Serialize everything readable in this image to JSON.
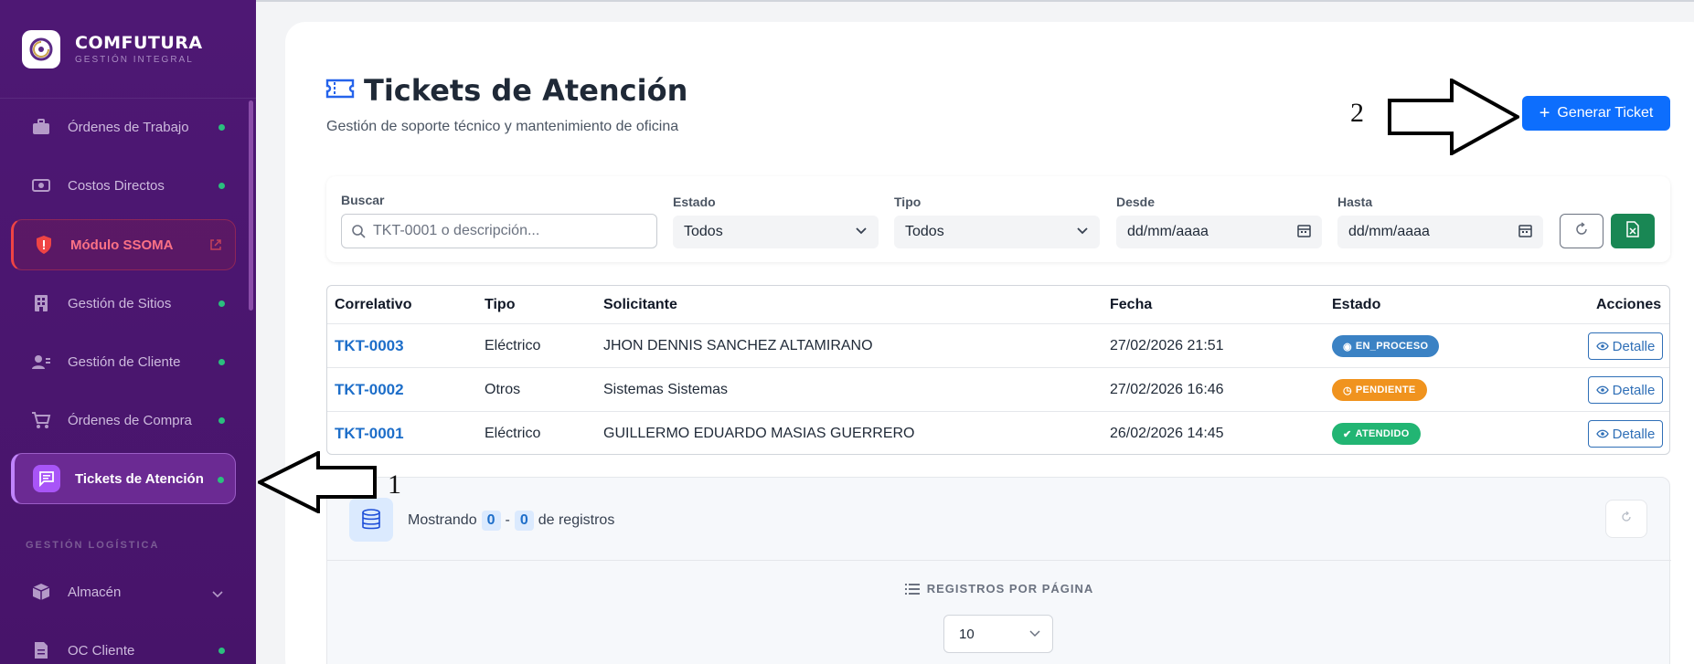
{
  "brand": {
    "name": "COMFUTURA",
    "sub": "GESTIÓN INTEGRAL"
  },
  "sidebar": {
    "items": [
      {
        "label": "Órdenes de Trabajo",
        "icon": "briefcase-icon"
      },
      {
        "label": "Costos Directos",
        "icon": "cash-icon"
      },
      {
        "label": "Módulo SSOMA",
        "icon": "shield-icon"
      },
      {
        "label": "Gestión de Sitios",
        "icon": "building-icon"
      },
      {
        "label": "Gestión de Cliente",
        "icon": "user-card-icon"
      },
      {
        "label": "Órdenes de Compra",
        "icon": "cart-icon"
      },
      {
        "label": "Tickets de Atención",
        "icon": "chat-icon"
      }
    ],
    "section_label": "GESTIÓN LOGÍSTICA",
    "logistics_items": [
      {
        "label": "Almacén",
        "icon": "box-icon"
      },
      {
        "label": "OC Cliente",
        "icon": "document-icon"
      }
    ]
  },
  "page": {
    "title": "Tickets de Atención",
    "subtitle": "Gestión de soporte técnico y mantenimiento de oficina",
    "generate_button": "Generar Ticket"
  },
  "filters": {
    "search_label": "Buscar",
    "search_placeholder": "TKT-0001 o descripción...",
    "estado_label": "Estado",
    "estado_value": "Todos",
    "tipo_label": "Tipo",
    "tipo_value": "Todos",
    "desde_label": "Desde",
    "desde_value": "dd/mm/aaaa",
    "hasta_label": "Hasta",
    "hasta_value": "dd/mm/aaaa"
  },
  "table": {
    "headers": [
      "Correlativo",
      "Tipo",
      "Solicitante",
      "Fecha",
      "Estado",
      "Acciones"
    ],
    "rows": [
      {
        "correlativo": "TKT-0003",
        "tipo": "Eléctrico",
        "solicitante": "JHON DENNIS SANCHEZ ALTAMIRANO",
        "fecha": "27/02/2026 21:51",
        "estado": "EN_PROCESO",
        "estado_color": "#3b82c4",
        "accion": "Detalle"
      },
      {
        "correlativo": "TKT-0002",
        "tipo": "Otros",
        "solicitante": "Sistemas Sistemas",
        "fecha": "27/02/2026 16:46",
        "estado": "PENDIENTE",
        "estado_color": "#f0931e",
        "accion": "Detalle"
      },
      {
        "correlativo": "TKT-0001",
        "tipo": "Eléctrico",
        "solicitante": "GUILLERMO EDUARDO MASIAS GUERRERO",
        "fecha": "26/02/2026 14:45",
        "estado": "ATENDIDO",
        "estado_color": "#22b573",
        "accion": "Detalle"
      }
    ]
  },
  "footer": {
    "showing_prefix": "Mostrando",
    "from": "0",
    "sep": "-",
    "to": "0",
    "suffix": "de registros",
    "per_page_label": "REGISTROS POR PÁGINA",
    "per_page_value": "10"
  },
  "annotations": {
    "one": "1",
    "two": "2"
  },
  "colors": {
    "sidebar": "#4a1670",
    "primary": "#0d6efd",
    "excel": "#198754",
    "link": "#1d6ec9"
  }
}
